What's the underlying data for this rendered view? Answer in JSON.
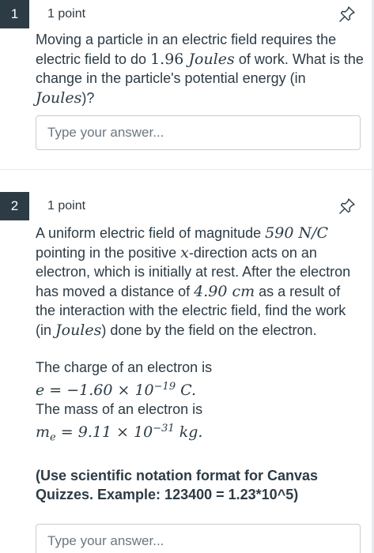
{
  "questions": [
    {
      "number": "1",
      "points": "1 point",
      "text": {
        "p1": "Moving a particle in an electric field requires the electric field to do ",
        "m1": "1.96",
        "m2": "Joules",
        "p2": " of work. What is the change in the particle's potential energy (in ",
        "m3": "Joules",
        "p3": ")?"
      },
      "placeholder": "Type your answer..."
    },
    {
      "number": "2",
      "points": "1 point",
      "text": {
        "p1": "A uniform electric field of magnitude ",
        "m1": "590 N/C",
        "p2": " pointing in the positive ",
        "m2": "x",
        "p3": "-direction acts on an electron, which is initially at rest. After the electron has moved a distance of ",
        "m3": "4.90 cm",
        "p4": " as a result of the interaction with the electric field, find the work (in ",
        "m4": "Joules",
        "p5": ") done by the field on the electron.",
        "charge_label": "The charge of an electron is",
        "charge_formula": "e = −1.60 × 10",
        "charge_exp": "−19",
        "charge_unit": " C.",
        "mass_label": "The mass of an electron is",
        "mass_formula_m": "m",
        "mass_formula_sub": "e",
        "mass_formula": " = 9.11 × 10",
        "mass_exp": "−31",
        "mass_unit": " kg.",
        "note": "(Use scientific notation format for Canvas Quizzes. Example: 123400 = 1.23*10^5)"
      },
      "placeholder": "Type your answer..."
    }
  ]
}
